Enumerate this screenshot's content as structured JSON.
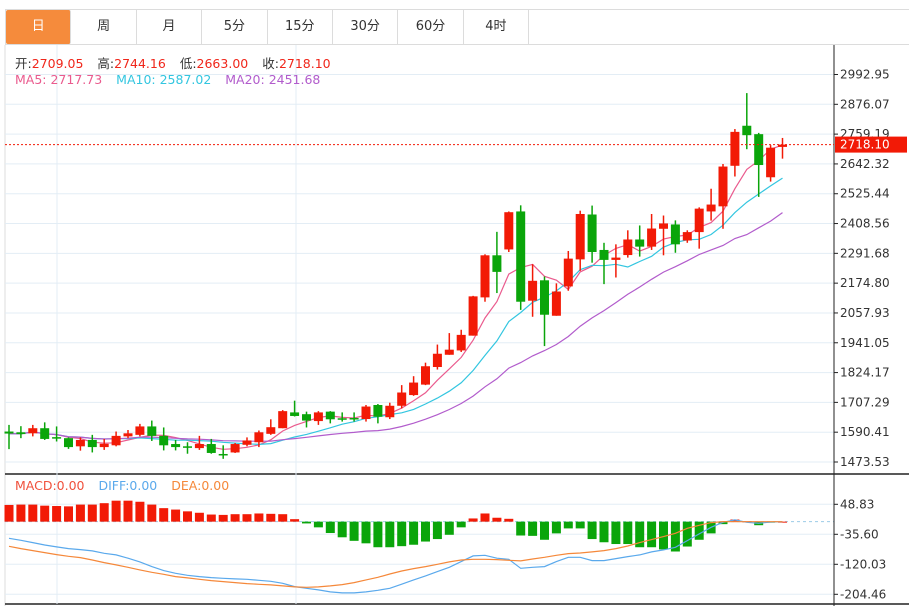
{
  "tabs": [
    {
      "label": "日",
      "active": true
    },
    {
      "label": "周",
      "active": false
    },
    {
      "label": "月",
      "active": false
    },
    {
      "label": "5分",
      "active": false
    },
    {
      "label": "15分",
      "active": false
    },
    {
      "label": "30分",
      "active": false
    },
    {
      "label": "60分",
      "active": false
    },
    {
      "label": "4时",
      "active": false
    }
  ],
  "ohlc_info": {
    "open_label": "开:",
    "open": "2709.05",
    "high_label": "高:",
    "high": "2744.16",
    "low_label": "低:",
    "low": "2663.00",
    "close_label": "收:",
    "close": "2718.10"
  },
  "ma_info": {
    "ma5": "MA5: 2717.73",
    "ma10": "MA10: 2587.02",
    "ma20": "MA20: 2451.68"
  },
  "macd_info": {
    "macd": "MACD:0.00",
    "diff": "DIFF:0.00",
    "dea": "DEA:0.00"
  },
  "colors": {
    "up": "#f21a06",
    "down": "#0aa50a",
    "active_tab": "#f58b3c",
    "ma5": "#ea5b8e",
    "ma10": "#33c6e0",
    "ma20": "#b25ccc",
    "diff": "#5aa9ec",
    "dea": "#f5883a",
    "macd_label": "#f0513c",
    "last_price_bg": "#f21a06"
  },
  "chart_data": [
    {
      "type": "candlestick",
      "candle_fields": [
        "open",
        "close",
        "low",
        "high"
      ],
      "y_ticks": [
        "2992.95",
        "2876.07",
        "2759.19",
        "2642.32",
        "2525.44",
        "2408.56",
        "2291.68",
        "2174.80",
        "2057.93",
        "1941.05",
        "1824.17",
        "1707.29",
        "1590.41",
        "1473.53"
      ],
      "ylim": [
        1473.53,
        2992.95
      ],
      "last_price": "2718.10",
      "ma_periods": [
        5,
        10,
        20
      ],
      "candles": [
        [
          1593,
          1585,
          1524,
          1619
        ],
        [
          1590,
          1583,
          1567,
          1614
        ],
        [
          1586,
          1606,
          1574,
          1619
        ],
        [
          1606,
          1564,
          1560,
          1629
        ],
        [
          1571,
          1567,
          1554,
          1613
        ],
        [
          1567,
          1532,
          1525,
          1570
        ],
        [
          1535,
          1560,
          1518,
          1570
        ],
        [
          1560,
          1532,
          1511,
          1580
        ],
        [
          1532,
          1545,
          1521,
          1564
        ],
        [
          1539,
          1576,
          1535,
          1593
        ],
        [
          1574,
          1586,
          1567,
          1599
        ],
        [
          1580,
          1613,
          1574,
          1623
        ],
        [
          1613,
          1576,
          1556,
          1636
        ],
        [
          1576,
          1539,
          1519,
          1609
        ],
        [
          1544,
          1532,
          1519,
          1560
        ],
        [
          1535,
          1531,
          1506,
          1551
        ],
        [
          1528,
          1544,
          1521,
          1576
        ],
        [
          1544,
          1509,
          1506,
          1564
        ],
        [
          1505,
          1501,
          1486,
          1539
        ],
        [
          1511,
          1544,
          1509,
          1548
        ],
        [
          1541,
          1558,
          1535,
          1570
        ],
        [
          1551,
          1590,
          1532,
          1597
        ],
        [
          1584,
          1610,
          1580,
          1641
        ],
        [
          1606,
          1673,
          1606,
          1677
        ],
        [
          1668,
          1654,
          1652,
          1714
        ],
        [
          1661,
          1636,
          1609,
          1671
        ],
        [
          1634,
          1668,
          1619,
          1673
        ],
        [
          1671,
          1641,
          1625,
          1673
        ],
        [
          1645,
          1643,
          1632,
          1668
        ],
        [
          1646,
          1642,
          1632,
          1668
        ],
        [
          1642,
          1691,
          1632,
          1697
        ],
        [
          1697,
          1651,
          1625,
          1701
        ],
        [
          1649,
          1694,
          1642,
          1706
        ],
        [
          1694,
          1746,
          1684,
          1775
        ],
        [
          1736,
          1785,
          1733,
          1810
        ],
        [
          1777,
          1849,
          1775,
          1863
        ],
        [
          1846,
          1898,
          1836,
          1934
        ],
        [
          1894,
          1914,
          1894,
          1979
        ],
        [
          1911,
          1972,
          1905,
          1992
        ],
        [
          1969,
          2123,
          1969,
          2125
        ],
        [
          2119,
          2284,
          2102,
          2288
        ],
        [
          2284,
          2219,
          2136,
          2376
        ],
        [
          2307,
          2453,
          2297,
          2456
        ],
        [
          2456,
          2102,
          2070,
          2480
        ],
        [
          2106,
          2184,
          2043,
          2249
        ],
        [
          2186,
          2051,
          1928,
          2201
        ],
        [
          2047,
          2142,
          2047,
          2174
        ],
        [
          2162,
          2271,
          2145,
          2301
        ],
        [
          2268,
          2446,
          2223,
          2459
        ],
        [
          2444,
          2297,
          2255,
          2479
        ],
        [
          2305,
          2266,
          2171,
          2333
        ],
        [
          2266,
          2275,
          2197,
          2327
        ],
        [
          2285,
          2346,
          2275,
          2382
        ],
        [
          2346,
          2318,
          2279,
          2401
        ],
        [
          2318,
          2389,
          2305,
          2446
        ],
        [
          2388,
          2409,
          2284,
          2440
        ],
        [
          2405,
          2327,
          2294,
          2421
        ],
        [
          2342,
          2375,
          2333,
          2382
        ],
        [
          2375,
          2467,
          2310,
          2472
        ],
        [
          2456,
          2483,
          2420,
          2545
        ],
        [
          2476,
          2632,
          2388,
          2642
        ],
        [
          2635,
          2768,
          2593,
          2779
        ],
        [
          2792,
          2755,
          2700,
          2920
        ],
        [
          2759,
          2638,
          2513,
          2764
        ],
        [
          2590,
          2706,
          2573,
          2716
        ],
        [
          2709.05,
          2718.1,
          2663.0,
          2744.16
        ]
      ]
    },
    {
      "type": "macd",
      "y_ticks": [
        "48.83",
        "-35.60",
        "-120.03",
        "-204.46"
      ],
      "ylim": [
        -204.46,
        48.83
      ],
      "macd": [
        47,
        48,
        48,
        45,
        44,
        43,
        48,
        48,
        52,
        59,
        59,
        56,
        48,
        38,
        34,
        29,
        25,
        20,
        19,
        21,
        21,
        23,
        22,
        21,
        7,
        -5,
        -16,
        -32,
        -44,
        -54,
        -61,
        -72,
        -72,
        -69,
        -65,
        -56,
        -49,
        -37,
        -16,
        9,
        23,
        11,
        8,
        -39,
        -40,
        -51,
        -33,
        -19,
        -19,
        -49,
        -58,
        -63,
        -63,
        -72,
        -72,
        -78,
        -84,
        -70,
        -51,
        -33,
        -7,
        6,
        1,
        -10,
        -2,
        0
      ],
      "diff": [
        -46.8,
        -52.4,
        -59,
        -65.6,
        -71.2,
        -75.9,
        -78.7,
        -82.4,
        -89,
        -93.7,
        -103,
        -113.4,
        -126.5,
        -137.8,
        -145.3,
        -150.9,
        -154.7,
        -157.5,
        -159.4,
        -161.2,
        -162.2,
        -165,
        -167.8,
        -173.4,
        -182.8,
        -187.5,
        -192.2,
        -197.8,
        -200.6,
        -200.6,
        -197.8,
        -193.1,
        -187.5,
        -176,
        -164,
        -152.8,
        -140.6,
        -128.4,
        -112.5,
        -96.5,
        -94.6,
        -103,
        -105.9,
        -131.2,
        -128.4,
        -126.5,
        -112.5,
        -100.3,
        -100.3,
        -109.6,
        -109.6,
        -104,
        -98.4,
        -93.7,
        -85.2,
        -79.6,
        -72.1,
        -53.4,
        -34.6,
        -15.8,
        -1.9,
        4.8,
        -1.9,
        -4.7,
        -1,
        0
      ],
      "dea": [
        -69.3,
        -75.9,
        -81.5,
        -87.1,
        -92.8,
        -97.4,
        -101.2,
        -107.8,
        -115.3,
        -121.8,
        -128.4,
        -135.9,
        -142.5,
        -148.1,
        -154.7,
        -158.4,
        -162.2,
        -165.9,
        -168.7,
        -171.5,
        -174.4,
        -176.2,
        -178.1,
        -180.9,
        -183.7,
        -184.7,
        -183.7,
        -180.9,
        -177.2,
        -171.5,
        -164,
        -156.5,
        -147.2,
        -139,
        -132.2,
        -126.5,
        -119.9,
        -113.4,
        -107.8,
        -105.9,
        -105.9,
        -106.8,
        -108.7,
        -110.6,
        -105,
        -100.3,
        -94.6,
        -89.9,
        -88.1,
        -85.2,
        -81.5,
        -75.9,
        -68.4,
        -59,
        -50.5,
        -42.1,
        -32.7,
        -18.7,
        -10.2,
        -2.7,
        0.1,
        0,
        0,
        0,
        0,
        0
      ]
    }
  ]
}
